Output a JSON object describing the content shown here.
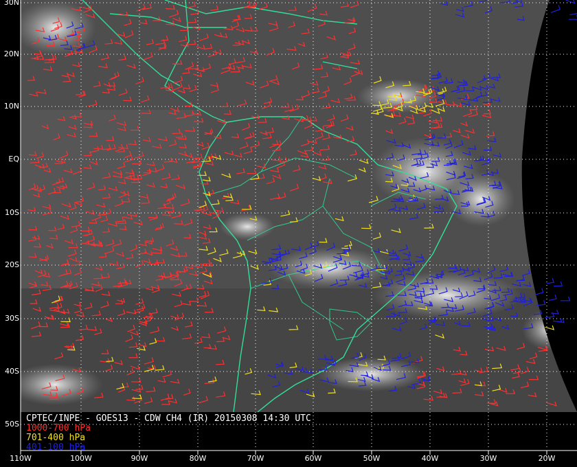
{
  "title": "CPTEC/INPE - GOES13 - CDW CH4 (IR) 20150308 14:30 UTC",
  "legend": [
    {
      "label": "1000-700 hPa",
      "color": "#ff3030"
    },
    {
      "label": "701-400 hPa",
      "color": "#f0e020"
    },
    {
      "label": "401-100 hPa",
      "color": "#2020e0"
    }
  ],
  "lat_labels": [
    "30N",
    "20N",
    "10N",
    "EQ",
    "10S",
    "20S",
    "30S",
    "40S",
    "50S"
  ],
  "lon_labels": [
    "110W",
    "100W",
    "90W",
    "80W",
    "70W",
    "60W",
    "50W",
    "40W",
    "30W",
    "20W"
  ],
  "colors": {
    "background": "#000000",
    "coastline": "#33dd99",
    "grid": "#ffffff",
    "low_level_wind": "#ff3030",
    "mid_level_wind": "#f0e020",
    "high_level_wind": "#2020e0"
  }
}
